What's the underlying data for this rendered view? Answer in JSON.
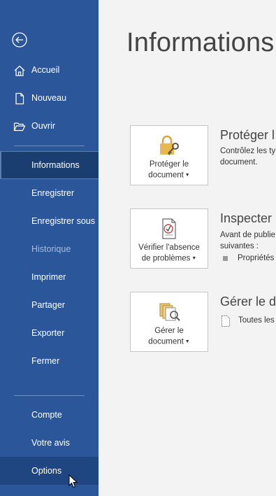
{
  "sidebar": {
    "nav_top": [
      {
        "label": "Accueil",
        "icon": "home-icon"
      },
      {
        "label": "Nouveau",
        "icon": "new-document-icon"
      },
      {
        "label": "Ouvrir",
        "icon": "open-folder-icon"
      }
    ],
    "nav_mid": [
      {
        "label": "Informations",
        "state": "active"
      },
      {
        "label": "Enregistrer",
        "state": "normal"
      },
      {
        "label": "Enregistrer sous",
        "state": "normal"
      },
      {
        "label": "Historique",
        "state": "disabled"
      },
      {
        "label": "Imprimer",
        "state": "normal"
      },
      {
        "label": "Partager",
        "state": "normal"
      },
      {
        "label": "Exporter",
        "state": "normal"
      },
      {
        "label": "Fermer",
        "state": "normal"
      }
    ],
    "nav_bottom": [
      {
        "label": "Compte",
        "state": "normal"
      },
      {
        "label": "Votre avis",
        "state": "normal"
      },
      {
        "label": "Options",
        "state": "hover"
      }
    ]
  },
  "main": {
    "title": "Informations",
    "protect": {
      "button_line1": "Protéger le",
      "button_line2": "document",
      "heading": "Protéger l",
      "desc_line1": "Contrôlez les ty",
      "desc_line2": "document."
    },
    "inspect": {
      "button_line1": "Vérifier l'absence",
      "button_line2": "de problèmes",
      "heading": "Inspecter",
      "desc_line1": "Avant de publie",
      "desc_line2": "suivantes :",
      "bullet_text": "Propriétés"
    },
    "manage": {
      "button_line1": "Gérer le",
      "button_line2": "document",
      "heading": "Gérer le d",
      "item_text": "Toutes les"
    }
  },
  "colors": {
    "sidebar_bg": "#2b579a",
    "sidebar_active": "#1a3e6f",
    "main_bg": "#f3f3f3"
  }
}
